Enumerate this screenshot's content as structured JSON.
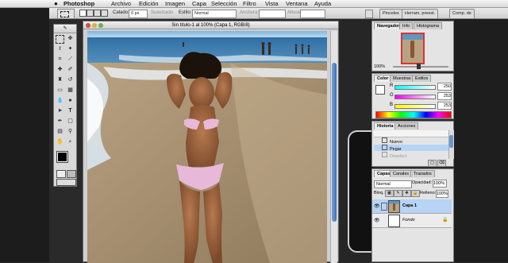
{
  "menubar": {
    "app": "Photoshop",
    "items": [
      "Archivo",
      "Edición",
      "Imagen",
      "Capa",
      "Selección",
      "Filtro",
      "Vista",
      "Ventana",
      "Ayuda"
    ]
  },
  "options_bar": {
    "calado_label": "Calado:",
    "calado_value": "0 px",
    "suavizado_label": "Suavizado",
    "estilo_label": "Estilo:",
    "estilo_value": "Normal",
    "anchura_label": "Anchura:",
    "altura_label": "Altura:",
    "tabs": [
      "Pinceles",
      "Herram. preest.",
      "Comp. de"
    ]
  },
  "document": {
    "title": "Sin título-1 al 100% (Capa 1, RGB/8)"
  },
  "navigator": {
    "tabs": [
      "Navegador",
      "Info",
      "Histograma"
    ],
    "zoom": "100%"
  },
  "color_panel": {
    "tabs": [
      "Color",
      "Muestras",
      "Estilos"
    ],
    "channels": [
      {
        "label": "R",
        "value": "250"
      },
      {
        "label": "G",
        "value": "253"
      },
      {
        "label": "B",
        "value": "253"
      }
    ]
  },
  "history_panel": {
    "tabs": [
      "Historia",
      "Acciones"
    ],
    "items": [
      "Nuevo",
      "Pegar",
      "Deselect"
    ]
  },
  "layers_panel": {
    "tabs": [
      "Capas",
      "Canales",
      "Trazados"
    ],
    "blend_mode": "Normal",
    "opacity_label": "Opacidad:",
    "opacity_value": "100%",
    "lock_label": "Bloq.:",
    "fill_label": "Relleno:",
    "fill_value": "100%",
    "layers": [
      {
        "name": "Capa 1"
      },
      {
        "name": "Fondo"
      }
    ]
  },
  "colors": {
    "selection_blue": "#b7d3f5",
    "panel_bg": "#e4e4e4"
  }
}
